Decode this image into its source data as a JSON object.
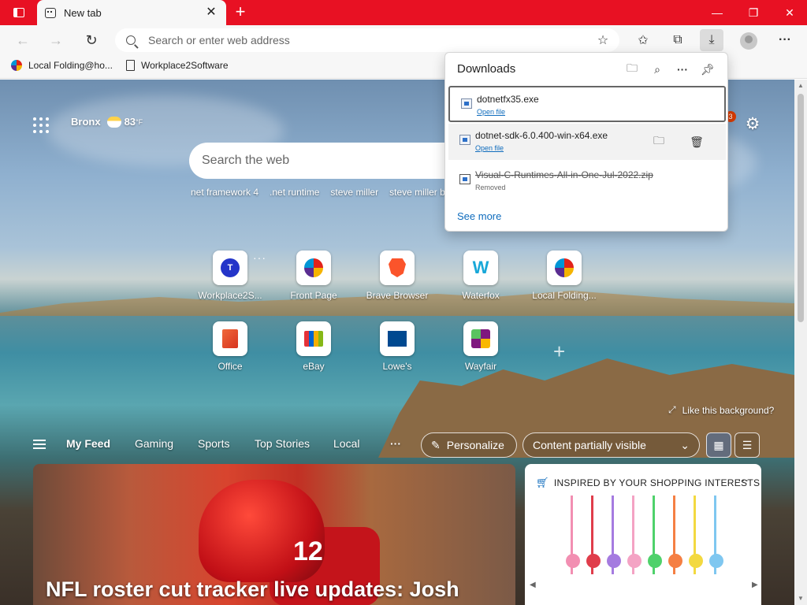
{
  "tab": {
    "title": "New tab"
  },
  "address_bar": {
    "placeholder": "Search or enter web address"
  },
  "favorites": [
    {
      "label": "Local Folding@ho..."
    },
    {
      "label": "Workplace2Software"
    }
  ],
  "weather": {
    "city": "Bronx",
    "temp": "83",
    "unit": "°F"
  },
  "search": {
    "placeholder": "Search the web",
    "trending": [
      "net framework 4",
      ".net runtime",
      "steve miller",
      "steve miller b"
    ]
  },
  "notifications": {
    "count": "3"
  },
  "quick_links": [
    {
      "label": "Workplace2S...",
      "glyph": "T"
    },
    {
      "label": "Front Page"
    },
    {
      "label": "Brave Browser"
    },
    {
      "label": "Waterfox",
      "glyph": "W"
    },
    {
      "label": "Local Folding..."
    },
    {
      "label": "Office"
    },
    {
      "label": "eBay"
    },
    {
      "label": "Lowe's"
    },
    {
      "label": "Wayfair"
    }
  ],
  "background": {
    "like_label": "Like this background?"
  },
  "feed": {
    "tabs": [
      "My Feed",
      "Gaming",
      "Sports",
      "Top Stories",
      "Local"
    ],
    "personalize": "Personalize",
    "visibility": "Content partially visible",
    "headline": "NFL roster cut tracker live updates: Josh",
    "jersey_number": "12",
    "shopping_title": "INSPIRED BY YOUR SHOPPING INTERESTS"
  },
  "downloads": {
    "title": "Downloads",
    "items": [
      {
        "name": "dotnetfx35.exe",
        "action": "Open file"
      },
      {
        "name": "dotnet-sdk-6.0.400-win-x64.exe",
        "action": "Open file"
      },
      {
        "name": "Visual-C-Runtimes-All-in-One-Jul-2022.zip",
        "status": "Removed"
      }
    ],
    "see_more": "See more"
  },
  "colors": {
    "titlebar": "#e81123",
    "link": "#0f6cbd",
    "accent_badge": "#d83b01"
  },
  "icons": {
    "tab_actions": "tab-actions-icon",
    "downloads": "download-icon",
    "settings": "gear-icon"
  }
}
